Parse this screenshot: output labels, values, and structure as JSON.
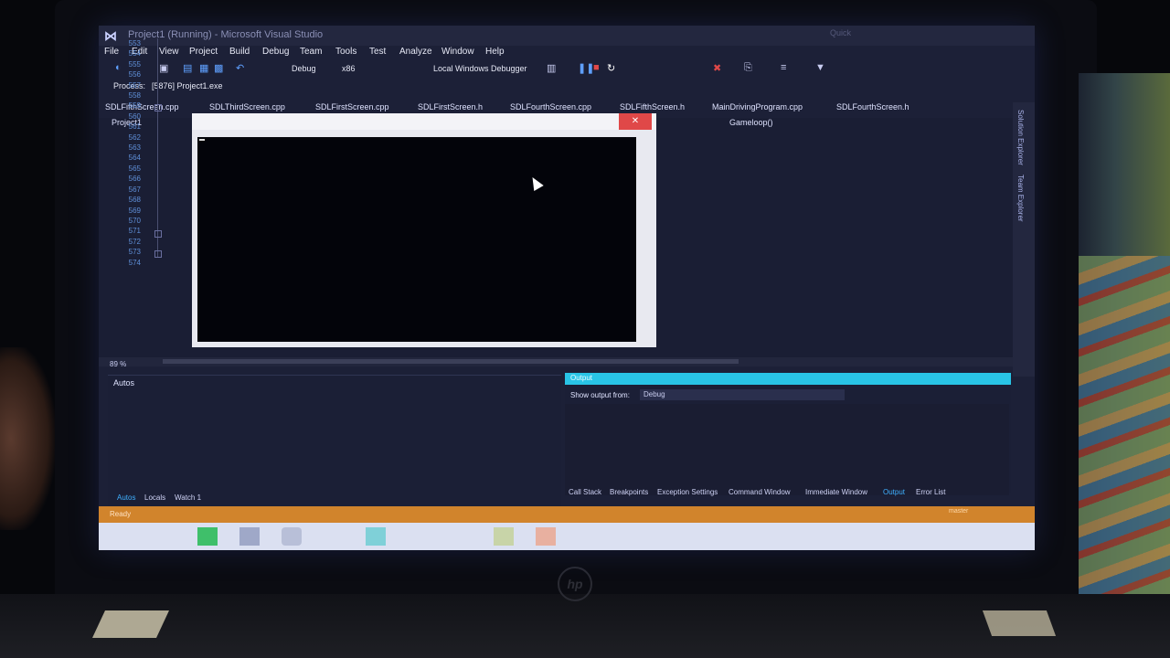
{
  "window": {
    "title": "Project1 (Running) - Microsoft Visual Studio",
    "quick_launch": "Quick"
  },
  "menu": [
    "File",
    "Edit",
    "View",
    "Project",
    "Build",
    "Debug",
    "Team",
    "Tools",
    "Test",
    "Analyze",
    "Window",
    "Help"
  ],
  "toolbar": {
    "config": "Debug",
    "platform": "x86",
    "debugger": "Local Windows Debugger"
  },
  "process": {
    "label": "Process:",
    "value": "[5876] Project1.exe"
  },
  "tabs": [
    "SDLFifthScreen.cpp",
    "SDLThirdScreen.cpp",
    "SDLFirstScreen.cpp",
    "SDLFirstScreen.h",
    "SDLFourthScreen.cpp",
    "SDLFifthScreen.h",
    "MainDrivingProgram.cpp",
    "SDLFourthScreen.h"
  ],
  "editor": {
    "project": "Project1",
    "function": "Gameloop()",
    "zoom": "89 %",
    "lines": [
      "553",
      "554",
      "555",
      "556",
      "557",
      "558",
      "559",
      "560",
      "561",
      "562",
      "563",
      "564",
      "565",
      "566",
      "567",
      "568",
      "569",
      "570",
      "571",
      "572",
      "573",
      "574"
    ]
  },
  "side_panels": {
    "solution_explorer": "Solution Explorer",
    "team_explorer": "Team Explorer"
  },
  "autos": {
    "title": "Autos",
    "tabs": [
      "Autos",
      "Locals",
      "Watch 1"
    ]
  },
  "output": {
    "show_output_from": "Show output from:",
    "source": "Debug",
    "tabs": [
      "Call Stack",
      "Breakpoints",
      "Exception Settings",
      "Command Window",
      "Immediate Window",
      "Output",
      "Error List"
    ]
  },
  "status": {
    "text": "Ready",
    "branch": "master"
  },
  "colors": {
    "status_bar": "#d1842c",
    "output_title": "#29c4e6",
    "console_close": "#e04848"
  }
}
